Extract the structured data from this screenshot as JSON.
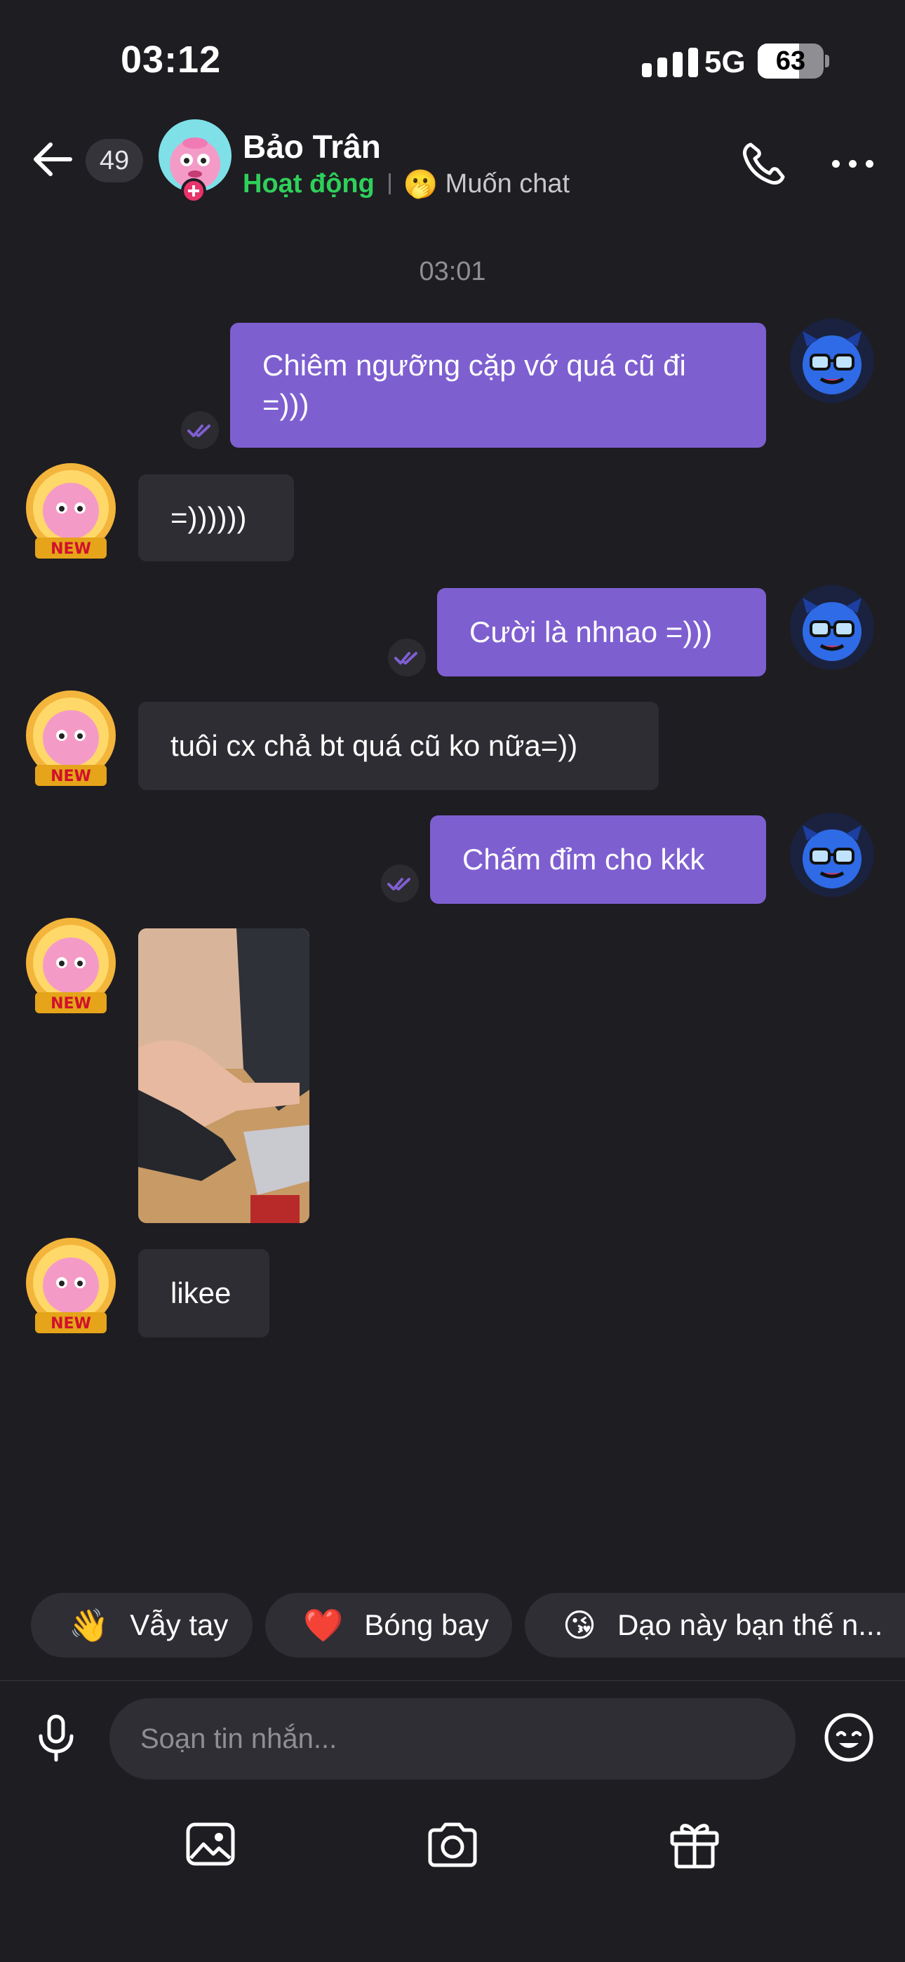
{
  "status_bar": {
    "time": "03:12",
    "network": "5G",
    "battery": "63",
    "battery_level": 0.63
  },
  "header": {
    "unread_count": "49",
    "contact_name": "Bảo Trân",
    "presence": "Hoạt động",
    "mood_emoji": "🫢",
    "mood_text": "Muốn chat"
  },
  "chat": {
    "time_separator": "03:01",
    "messages": [
      {
        "direction": "out",
        "text": "Chiêm ngưỡng cặp vớ quá cũ đi =)))"
      },
      {
        "direction": "in",
        "text": "=))))))"
      },
      {
        "direction": "out",
        "text": "Cười là nhnao =)))"
      },
      {
        "direction": "in",
        "text": "tuôi cx chả bt quá cũ ko nữa=))"
      },
      {
        "direction": "out",
        "text": "Chấm đỉm cho kkk"
      },
      {
        "direction": "in",
        "type": "photo"
      },
      {
        "direction": "in",
        "text": "likee"
      }
    ],
    "peer_avatar_badge": "NEW"
  },
  "quick_replies": [
    {
      "emoji": "👋",
      "label": "Vẫy tay"
    },
    {
      "emoji": "❤️",
      "label": "Bóng bay"
    },
    {
      "emoji": "😘",
      "label": "Dạo này bạn thế n..."
    }
  ],
  "composer": {
    "placeholder": "Soạn tin nhắn..."
  },
  "colors": {
    "outgoing_bubble": "#7e5fd0",
    "incoming_bubble": "#2e2d33",
    "presence_green": "#2fd05a",
    "background": "#1e1d22"
  },
  "icons": [
    "back-arrow-icon",
    "phone-icon",
    "more-dots-icon",
    "read-check-icon",
    "mic-icon",
    "emoji-icon",
    "image-icon",
    "camera-icon",
    "gift-icon"
  ]
}
